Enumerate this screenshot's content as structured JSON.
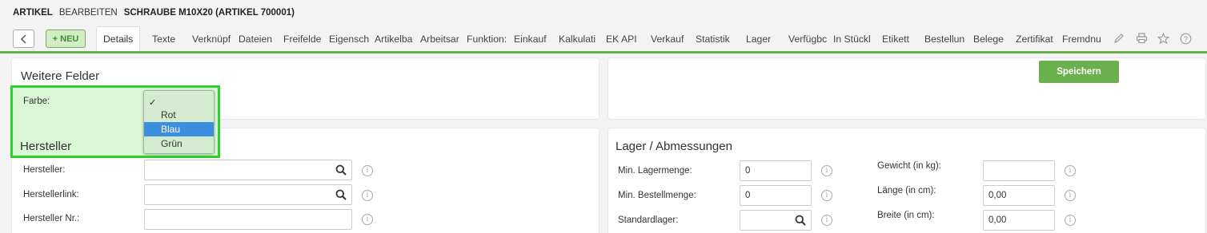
{
  "header": {
    "crumb_module": "ARTIKEL",
    "crumb_action": "BEARBEITEN",
    "crumb_title": "SCHRAUBE M10X20 (ARTIKEL 700001)"
  },
  "toolbar": {
    "back_icon": "chevron-left-icon",
    "new_label": "+ NEU",
    "tabs": [
      "Details",
      "Texte",
      "Verknüpf",
      "Dateien",
      "Freifelde",
      "Eigensch",
      "Artikelba",
      "Arbeitsar",
      "Funktion:",
      "Einkauf",
      "Kalkulati",
      "EK API",
      "Verkauf",
      "Statistik",
      "Lager",
      "Verfügbc",
      "In Stückl",
      "Etikett",
      "Bestellun",
      "Belege",
      "Zertifikat",
      "Fremdnu"
    ],
    "active_tab": "Details",
    "icons": [
      "pencil-icon",
      "printer-icon",
      "star-icon",
      "help-icon"
    ]
  },
  "weitere": {
    "title": "Weitere Felder",
    "farbe_label": "Farbe:",
    "dropdown_options": [
      "",
      "Rot",
      "Blau",
      "Grün"
    ],
    "dropdown_check": "✓",
    "dropdown_selected": "Blau"
  },
  "right_top": {
    "save_label": "Speichern"
  },
  "hersteller": {
    "title": "Hersteller",
    "fields": [
      {
        "label": "Hersteller:",
        "value": ""
      },
      {
        "label": "Herstellerlink:",
        "value": ""
      },
      {
        "label": "Hersteller Nr.:",
        "value": ""
      }
    ]
  },
  "lager": {
    "title": "Lager / Abmessungen",
    "left_fields": [
      {
        "label": "Min. Lagermenge:",
        "value": "0"
      },
      {
        "label": "Min. Bestellmenge:",
        "value": "0"
      },
      {
        "label": "Standardlager:",
        "value": ""
      }
    ],
    "right_fields": [
      {
        "label": "Gewicht (in kg):",
        "value": ""
      },
      {
        "label": "Länge (in cm):",
        "value": "0,00"
      },
      {
        "label": "Breite (in cm):",
        "value": "0,00"
      }
    ]
  },
  "info_glyph": "i"
}
